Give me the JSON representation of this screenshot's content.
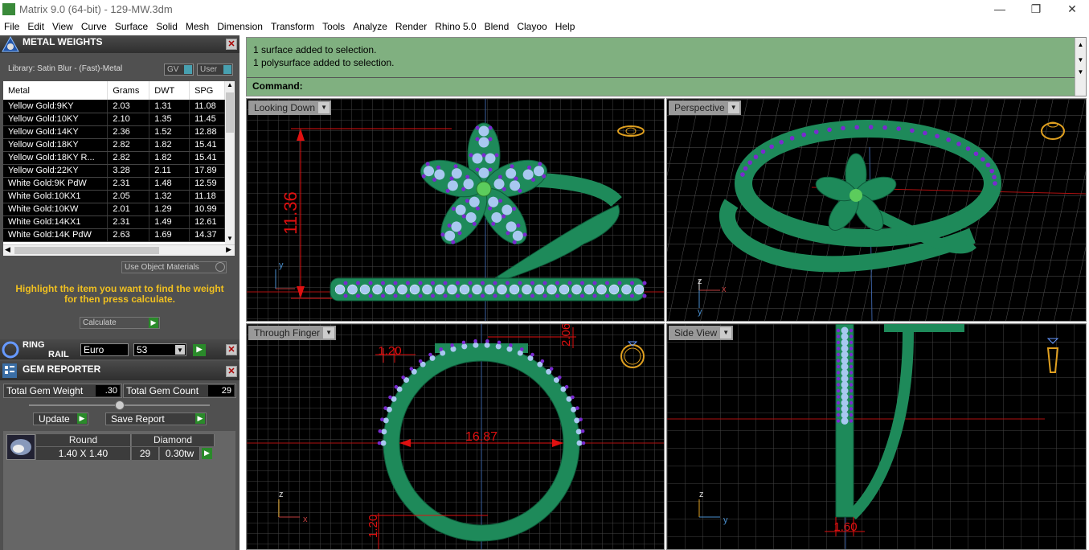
{
  "window": {
    "title": "Matrix 9.0 (64-bit) - 129-MW.3dm"
  },
  "menu": [
    "File",
    "Edit",
    "View",
    "Curve",
    "Surface",
    "Solid",
    "Mesh",
    "Dimension",
    "Transform",
    "Tools",
    "Analyze",
    "Render",
    "Rhino 5.0",
    "Blend",
    "Clayoo",
    "Help"
  ],
  "metal_weights": {
    "title": "METAL WEIGHTS",
    "library": "Library: Satin Blur - (Fast)-Metal",
    "toggle_gv": "GV",
    "toggle_user": "User",
    "columns": [
      "Metal",
      "Grams",
      "DWT",
      "SPG"
    ],
    "rows": [
      [
        "Yellow Gold:9KY",
        "2.03",
        "1.31",
        "11.08"
      ],
      [
        "Yellow Gold:10KY",
        "2.10",
        "1.35",
        "11.45"
      ],
      [
        "Yellow Gold:14KY",
        "2.36",
        "1.52",
        "12.88"
      ],
      [
        "Yellow Gold:18KY",
        "2.82",
        "1.82",
        "15.41"
      ],
      [
        "Yellow Gold:18KY R...",
        "2.82",
        "1.82",
        "15.41"
      ],
      [
        "Yellow Gold:22KY",
        "3.28",
        "2.11",
        "17.89"
      ],
      [
        "White Gold:9K PdW",
        "2.31",
        "1.48",
        "12.59"
      ],
      [
        "White Gold:10KX1",
        "2.05",
        "1.32",
        "11.18"
      ],
      [
        "White Gold:10KW",
        "2.01",
        "1.29",
        "10.99"
      ],
      [
        "White Gold:14KX1",
        "2.31",
        "1.49",
        "12.61"
      ],
      [
        "White Gold:14K PdW",
        "2.63",
        "1.69",
        "14.37"
      ]
    ],
    "use_object_materials": "Use Object Materials",
    "instruction": "Highlight the item you want to find the weight for then press calculate.",
    "calculate": "Calculate"
  },
  "ring_rail": {
    "title_line1": "RING",
    "title_line2": "RAIL",
    "system": "Euro",
    "size": "53"
  },
  "gem_reporter": {
    "title": "GEM REPORTER",
    "total_weight_label": "Total Gem Weight",
    "total_weight": ".30",
    "total_count_label": "Total Gem Count",
    "total_count": "29",
    "update": "Update",
    "save_report": "Save Report",
    "gem": {
      "cut": "Round",
      "type": "Diamond",
      "size": "1.40 X 1.40",
      "count": "29",
      "weight": "0.30tw"
    }
  },
  "command": {
    "history": [
      "1 surface added to selection.",
      "1 polysurface added to selection."
    ],
    "prompt": "Command:"
  },
  "viewports": {
    "top_left": {
      "label": "Looking Down",
      "dim": "11.36"
    },
    "top_right": {
      "label": "Perspective"
    },
    "bottom_left": {
      "label": "Through Finger",
      "dim_width": "1.20",
      "dim_top": "2.06",
      "dim_diameter": "16.87",
      "dim_bottom": "1.20"
    },
    "bottom_right": {
      "label": "Side View",
      "dim_width": "1.60"
    }
  },
  "axis": {
    "x": "x",
    "y": "y",
    "z": "z"
  },
  "colors": {
    "ring": "#1e8a5a",
    "gem": "#a8c8f0",
    "prong": "#7a2ad0",
    "dimension": "#e01010",
    "command_bg": "#80b080"
  }
}
